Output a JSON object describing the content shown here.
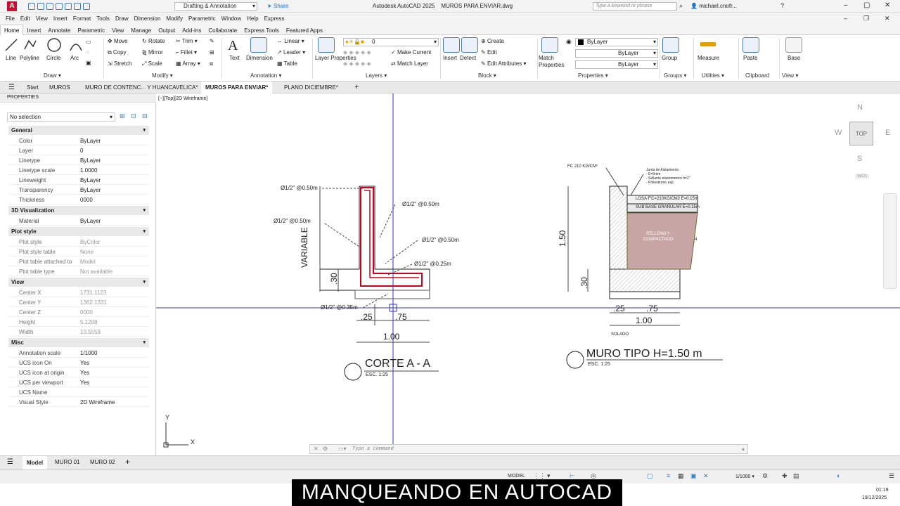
{
  "app": {
    "logo_letter": "A",
    "workspace": "Drafting & Annotation",
    "share": "Share",
    "title": "Autodesk AutoCAD 2025",
    "filename": "MUROS PARA ENVIAR.dwg",
    "search_placeholder": "Type a keyword or phrase",
    "user": "michael.cnofr...",
    "help": "?"
  },
  "menu": [
    "File",
    "Edit",
    "View",
    "Insert",
    "Format",
    "Tools",
    "Draw",
    "Dimension",
    "Modify",
    "Parametric",
    "Window",
    "Help",
    "Express"
  ],
  "ribbon_tabs": [
    "Home",
    "Insert",
    "Annotate",
    "Parametric",
    "View",
    "Manage",
    "Output",
    "Add-ins",
    "Collaborate",
    "Express Tools",
    "Featured Apps"
  ],
  "ribbon": {
    "draw": {
      "name": "Draw",
      "line": "Line",
      "polyline": "Polyline",
      "circle": "Circle",
      "arc": "Arc"
    },
    "modify": {
      "name": "Modify",
      "move": "Move",
      "rotate": "Rotate",
      "trim": "Trim",
      "copy": "Copy",
      "mirror": "Mirror",
      "fillet": "Fillet",
      "stretch": "Stretch",
      "scale": "Scale",
      "array": "Array"
    },
    "annotation": {
      "name": "Annotation",
      "text": "Text",
      "dimension": "Dimension",
      "linear": "Linear",
      "leader": "Leader",
      "table": "Table"
    },
    "layers": {
      "name": "Layers",
      "layer_properties": "Layer Properties",
      "current_layer": "0",
      "make_current": "Make Current",
      "match_layer": "Match Layer"
    },
    "block": {
      "name": "Block",
      "insert": "Insert",
      "detect": "Detect",
      "create": "Create",
      "edit": "Edit",
      "edit_attributes": "Edit Attributes"
    },
    "properties": {
      "name": "Properties",
      "match": "Match Properties",
      "color": "ByLayer",
      "linetype": "ByLayer",
      "lineweight": "ByLayer"
    },
    "groups": {
      "name": "Groups",
      "group": "Group"
    },
    "utilities": {
      "name": "Utilities",
      "measure": "Measure"
    },
    "clipboard": {
      "name": "Clipboard",
      "paste": "Paste"
    },
    "view": {
      "name": "View",
      "base": "Base"
    }
  },
  "doc_tabs": {
    "start": "Start",
    "tab1": "MUROS",
    "tab2": "MURO DE CONTENC... Y HUANCAVELICA*",
    "tab3": "MUROS PARA ENVIAR*",
    "tab4": "PLANO DICIEMBRE*",
    "add": "+"
  },
  "properties_panel": {
    "title": "PROPERTIES",
    "selection": "No selection",
    "sections": {
      "general": "General",
      "visual3d": "3D Visualization",
      "plotstyle": "Plot style",
      "view": "View",
      "misc": "Misc"
    },
    "general": [
      {
        "k": "Color",
        "v": "ByLayer"
      },
      {
        "k": "Layer",
        "v": "0"
      },
      {
        "k": "Linetype",
        "v": "ByLayer"
      },
      {
        "k": "Linetype scale",
        "v": "1.0000"
      },
      {
        "k": "Lineweight",
        "v": "ByLayer"
      },
      {
        "k": "Transparency",
        "v": "ByLayer"
      },
      {
        "k": "Thickness",
        "v": "0000"
      }
    ],
    "visual3d": [
      {
        "k": "Material",
        "v": "ByLayer"
      }
    ],
    "plotstyle": [
      {
        "k": "Plot style",
        "v": "ByColor"
      },
      {
        "k": "Plot style table",
        "v": "None"
      },
      {
        "k": "Plot table attached to",
        "v": "Model"
      },
      {
        "k": "Plot table type",
        "v": "Not available"
      }
    ],
    "view": [
      {
        "k": "Center X",
        "v": "1731.1123"
      },
      {
        "k": "Center Y",
        "v": "1362.1331"
      },
      {
        "k": "Center Z",
        "v": "0000"
      },
      {
        "k": "Height",
        "v": "5.1208"
      },
      {
        "k": "Width",
        "v": "10.5559"
      }
    ],
    "misc": [
      {
        "k": "Annotation scale",
        "v": "1/1000"
      },
      {
        "k": "UCS icon On",
        "v": "Yes"
      },
      {
        "k": "UCS icon at origin",
        "v": "Yes"
      },
      {
        "k": "UCS per viewport",
        "v": "Yes"
      },
      {
        "k": "UCS Name",
        "v": ""
      },
      {
        "k": "Visual Style",
        "v": "2D Wireframe"
      }
    ]
  },
  "viewport": {
    "label": "[−][Top][2D Wireframe]",
    "viewcube": {
      "n": "N",
      "s": "S",
      "e": "E",
      "w": "W",
      "top": "TOP",
      "wcs": "WCS"
    },
    "ucs": {
      "x": "X",
      "y": "Y"
    }
  },
  "drawing1": {
    "title": "CORTE A - A",
    "scale": "ESC. 1:25",
    "variable": "VARIABLE",
    "dim30": ".30",
    "dim25": ".25",
    "dim75": ".75",
    "dim100": "1.00",
    "rebar1": "Ø1/2\" @0.50m",
    "rebar2": "Ø1/2\" @0.50m",
    "rebar3": "Ø1/2\" @0.50m",
    "rebar4": "Ø1/2\" @0.50m",
    "rebar5": "Ø1/2\" @0.25m",
    "rebar6": "Ø1/2\" @0.35m"
  },
  "drawing2": {
    "title": "MURO TIPO H=1.50 m",
    "scale": "ESC. 1:25",
    "h150": "1.50",
    "dim30": ".30",
    "dim25": ".25",
    "dim75": ".75",
    "dim100": "1.00",
    "fc": "FC 210 KG/CM²",
    "joint1": "Junta de Aislamiento",
    "joint2": "- E=5mm",
    "joint3": "- Sellante elastomerico h=2\"",
    "joint4": "- Poliestireno exp.",
    "losa": "LOSA F'C=210KG/CM2 E=0.15m",
    "subbase": "SUB BASE GRANULAR E=0.15m",
    "relleno": "RELLENO Y COMPACTADO",
    "solado": "SOLADO",
    "slope": "4"
  },
  "command": {
    "placeholder": "Type a command"
  },
  "layouts": {
    "model": "Model",
    "l1": "MURO 01",
    "l2": "MURO 02",
    "add": "+"
  },
  "status": {
    "model": "MODEL",
    "scale": "1/1000"
  },
  "clock": {
    "time": "01:19",
    "date": "19/12/2025"
  },
  "banner": "MANQUEANDO EN AUTOCAD",
  "colors": {
    "rebar": "#d0001a",
    "crosshair": "#3232c8",
    "hatch": "#c9a6a6"
  }
}
